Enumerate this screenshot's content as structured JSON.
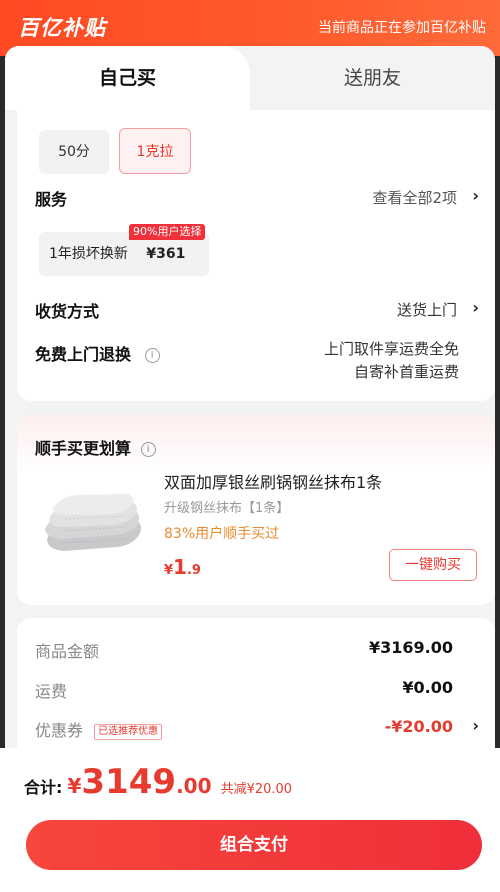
{
  "banner": {
    "logo": "百亿补贴",
    "notice": "当前商品正在参加百亿补贴"
  },
  "tabs": {
    "self": "自己买",
    "friend": "送朋友"
  },
  "spec": {
    "options": [
      "50分",
      "1克拉"
    ],
    "selected": "1克拉"
  },
  "service": {
    "label": "服务",
    "view_all": "查看全部2项",
    "badge": "90%用户选择",
    "chip": "1年损坏换新",
    "chip_price": "¥361"
  },
  "delivery": {
    "label": "收货方式",
    "value": "送货上门"
  },
  "return": {
    "label": "免费上门退换",
    "line1": "上门取件享运费全免",
    "line2": "自寄补首重运费"
  },
  "addon": {
    "title": "顺手买更划算",
    "product_name": "双面加厚银丝刷锅钢丝抹布1条",
    "product_sub": "升级钢丝抹布【1条】",
    "stat": "83%用户顺手买过",
    "price_currency": "¥",
    "price_int": "1",
    "price_dec": ".9",
    "buy_label": "一键购买"
  },
  "fees": {
    "amount_label": "商品金额",
    "amount_value": "¥3169.00",
    "shipping_label": "运费",
    "shipping_value": "¥0.00",
    "coupon_label": "优惠券",
    "coupon_tag": "已选推荐优惠",
    "coupon_value": "-¥20.00"
  },
  "footer": {
    "total_label": "合计:",
    "currency": "¥",
    "total_int": "3149",
    "total_dec": ".00",
    "saved": "共减¥20.00",
    "pay_label": "组合支付"
  },
  "colors": {
    "accent": "#e63b2e",
    "banner": "#ff4a24",
    "pay_button": "#f0303b",
    "stat_orange": "#e88c2f"
  }
}
